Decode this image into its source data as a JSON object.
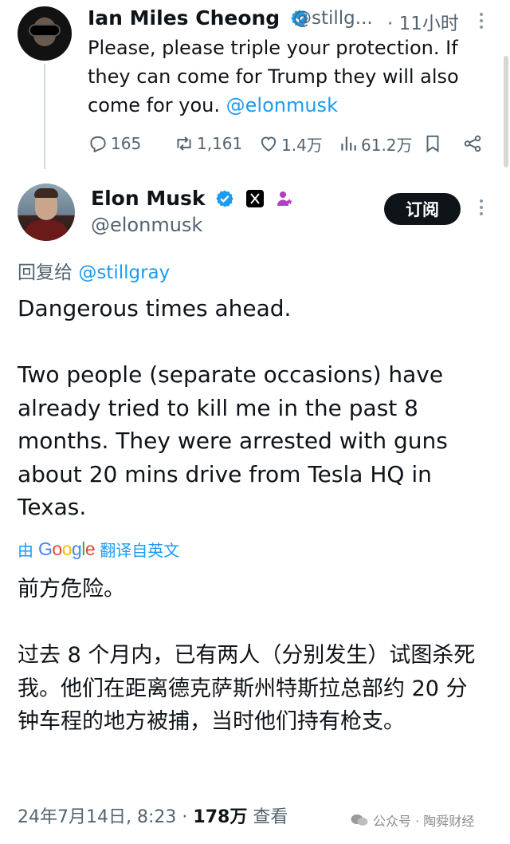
{
  "quoted_tweet": {
    "author_name": "Ian Miles Cheong",
    "author_handle": "@stillg...",
    "separator": "·",
    "time": "11小时",
    "text_prefix": "Please, please triple your protection. If they can come for Trump they will also come for you. ",
    "mention": "@elonmusk",
    "stats": {
      "replies": "165",
      "reposts": "1,161",
      "likes": "1.4万",
      "views": "61.2万"
    },
    "icons": [
      "reply-icon",
      "repost-icon",
      "like-icon",
      "views-icon",
      "bookmark-icon",
      "share-icon"
    ]
  },
  "main_tweet": {
    "author_name": "Elon Musk",
    "author_handle": "@elonmusk",
    "subscribe_label": "订阅",
    "reply_prefix": "回复给 ",
    "reply_target": "@stillgray",
    "paragraphs": [
      "Dangerous times ahead.",
      "Two people (separate occasions) have already tried to kill me in the past 8 months. They were arrested with guns about 20 mins drive from Tesla HQ in Texas."
    ],
    "translation": {
      "by": "由",
      "provider": "Google",
      "label": "翻译自英文"
    },
    "translated_paragraphs": [
      "前方危险。",
      "过去 8 个月内，已有两人（分别发生）试图杀死我。他们在距离德克萨斯州特斯拉总部约 20 分钟车程的地方被捕，当时他们持有枪支。"
    ],
    "timestamp": "24年7月14日, 8:23",
    "separator": "·",
    "views_count": "178万",
    "views_label": "查看"
  },
  "watermark": {
    "text": "公众号 · 陶舜财经"
  },
  "colors": {
    "text": "#0f1419",
    "muted": "#536471",
    "link": "#1d9bf0",
    "verified": "#1d9bf0",
    "button_bg": "#0f1419"
  }
}
